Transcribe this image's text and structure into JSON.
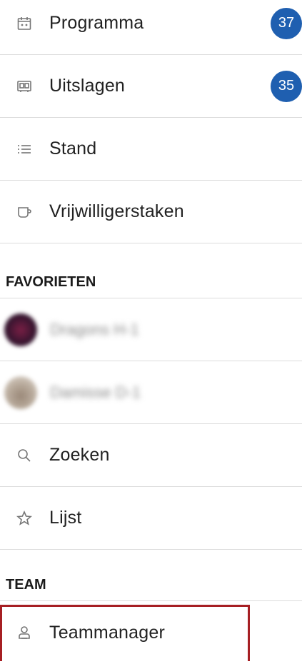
{
  "nav": {
    "items": [
      {
        "label": "Programma",
        "icon": "calendar-icon",
        "badge": "37"
      },
      {
        "label": "Uitslagen",
        "icon": "scoreboard-icon",
        "badge": "35"
      },
      {
        "label": "Stand",
        "icon": "list-icon"
      },
      {
        "label": "Vrijwilligerstaken",
        "icon": "cup-icon"
      }
    ]
  },
  "favorites": {
    "header": "FAVORIETEN",
    "items": [
      {
        "label": "Dragons H-1",
        "avatar_color": "#5a1b3a"
      },
      {
        "label": "Damisse D-1",
        "avatar_color": "#8a7766"
      }
    ],
    "search_label": "Zoeken",
    "list_label": "Lijst"
  },
  "team": {
    "header": "TEAM",
    "items": [
      {
        "label": "Teammanager",
        "icon": "person-badge-icon"
      }
    ]
  },
  "colors": {
    "badge": "#1f5fb0",
    "highlight_border": "#a61f23",
    "divider": "#dcdcdc"
  }
}
